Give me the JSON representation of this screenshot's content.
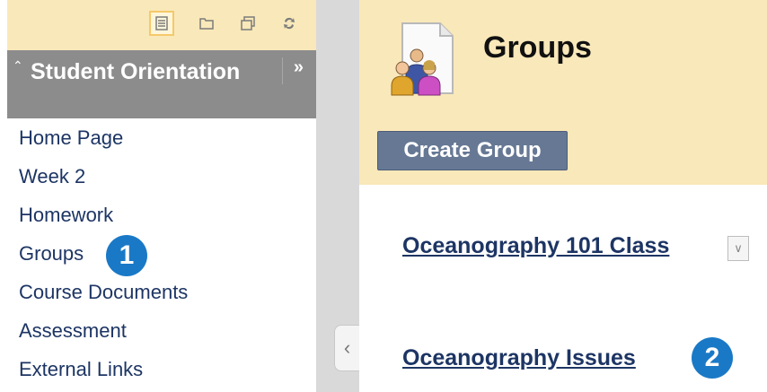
{
  "sidebar": {
    "toolbar_icons": [
      "list-view-icon",
      "folder-view-icon",
      "window-icon",
      "refresh-icon"
    ],
    "course_title": "Student Orientation",
    "items": [
      {
        "label": "Home Page"
      },
      {
        "label": "Week 2"
      },
      {
        "label": "Homework"
      },
      {
        "label": "Groups"
      },
      {
        "label": "Course Documents"
      },
      {
        "label": "Assessment"
      },
      {
        "label": "External Links"
      }
    ]
  },
  "main": {
    "title": "Groups",
    "create_button": "Create Group",
    "groups": [
      {
        "name": "Oceanography 101 Class"
      },
      {
        "name": "Oceanography Issues"
      }
    ]
  },
  "callouts": [
    "1",
    "2"
  ],
  "colors": {
    "header_bg": "#f9e8b9",
    "sidebar_header_bg": "#8c8c8c",
    "link": "#1d3564",
    "callout": "#1a79c6",
    "button": "#667894"
  }
}
